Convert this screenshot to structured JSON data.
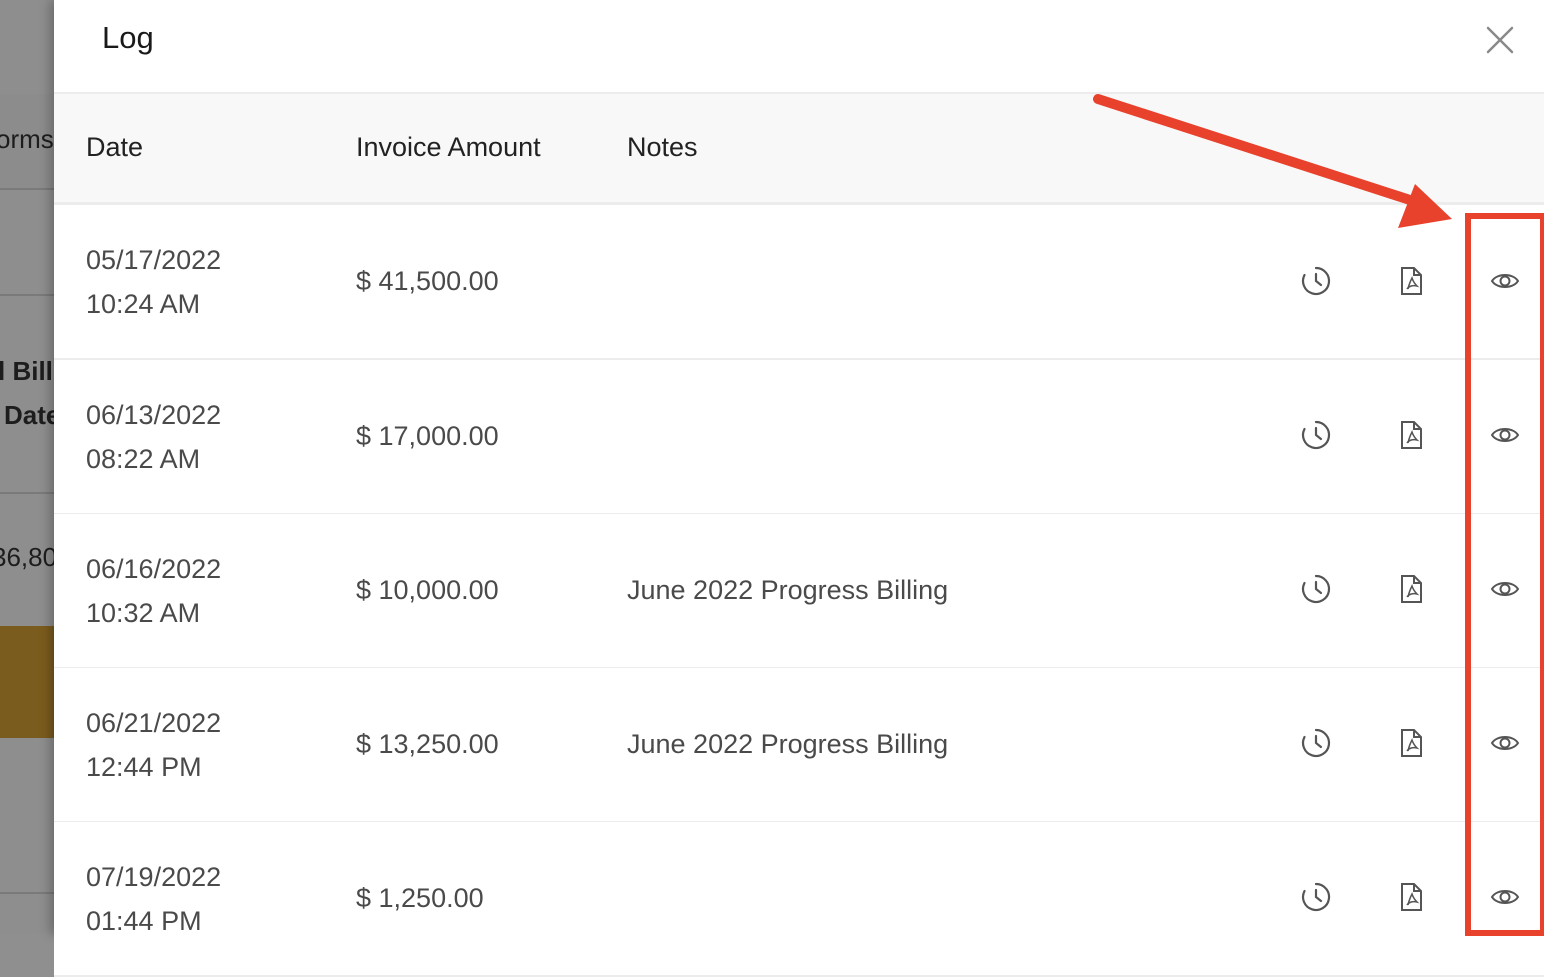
{
  "background": {
    "fragments": [
      "orms",
      "l Bill",
      "Date",
      "36,80"
    ]
  },
  "drawer": {
    "title": "Log",
    "close_icon": "close-icon"
  },
  "table": {
    "headers": [
      "Date",
      "Invoice Amount",
      "Notes"
    ],
    "rows": [
      {
        "date": "05/17/2022",
        "time": "10:24 AM",
        "amount": "$ 41,500.00",
        "note": ""
      },
      {
        "date": "06/13/2022",
        "time": "08:22 AM",
        "amount": "$ 17,000.00",
        "note": ""
      },
      {
        "date": "06/16/2022",
        "time": "10:32 AM",
        "amount": "$ 10,000.00",
        "note": "June 2022 Progress Billing"
      },
      {
        "date": "06/21/2022",
        "time": "12:44 PM",
        "amount": "$ 13,250.00",
        "note": "June 2022 Progress Billing"
      },
      {
        "date": "07/19/2022",
        "time": "01:44 PM",
        "amount": "$ 1,250.00",
        "note": ""
      }
    ],
    "row_icons": [
      "history-icon",
      "pdf-file-icon",
      "eye-icon"
    ]
  },
  "colors": {
    "annotation": "#e8412c",
    "icon": "#555555",
    "gold_band": "#7a5c1e"
  }
}
